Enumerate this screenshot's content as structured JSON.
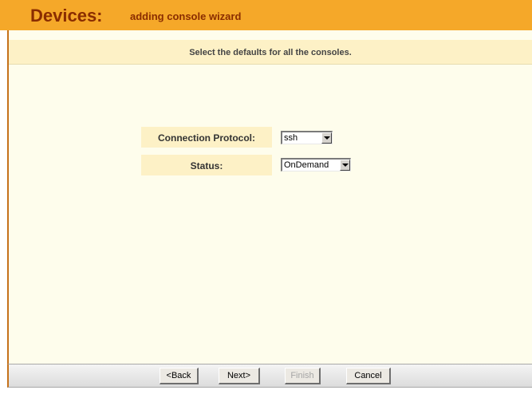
{
  "header": {
    "title": "Devices:",
    "subtitle": "adding console wizard"
  },
  "instruction": "Select the defaults for all the consoles.",
  "form": {
    "connection_protocol": {
      "label": "Connection Protocol:",
      "value": "ssh"
    },
    "status": {
      "label": "Status:",
      "value": "OnDemand"
    }
  },
  "buttons": {
    "back": "<Back",
    "next": "Next>",
    "finish": "Finish",
    "cancel": "Cancel"
  },
  "colors": {
    "header_bg": "#f5a829",
    "header_text": "#8a2d00",
    "content_bg": "#fefdec",
    "label_bg": "#fdf1c6"
  }
}
